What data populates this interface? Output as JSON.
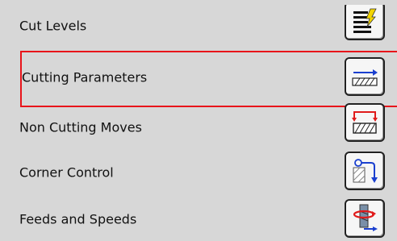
{
  "rows": [
    {
      "label": "Cut Levels",
      "icon": "cut-levels-icon"
    },
    {
      "label": "Cutting Parameters",
      "icon": "cutting-parameters-icon"
    },
    {
      "label": "Non Cutting Moves",
      "icon": "non-cutting-moves-icon"
    },
    {
      "label": "Corner Control",
      "icon": "corner-control-icon"
    },
    {
      "label": "Feeds and Speeds",
      "icon": "feeds-and-speeds-icon"
    }
  ],
  "colors": {
    "background": "#d7d7d7",
    "highlight": "#e8141a",
    "arrow_blue": "#1a3fcf",
    "arrow_red": "#e01b1b"
  }
}
